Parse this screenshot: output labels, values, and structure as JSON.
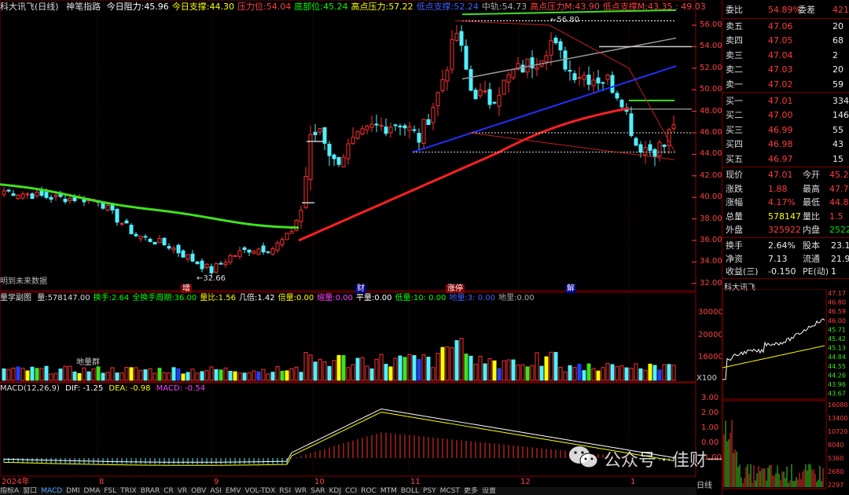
{
  "header": {
    "stock_name": "科大讯飞(日线)",
    "indicator": "神笔指路",
    "items": [
      {
        "label": "今日阻力:",
        "value": "45.96",
        "color": "#ffffff"
      },
      {
        "label": "今日支撑:",
        "value": "44.30",
        "color": "#ffff00"
      },
      {
        "label": "压力位:",
        "value": "54.04",
        "color": "#ff4040"
      },
      {
        "label": "底部位:",
        "value": "45.24",
        "color": "#00ff00"
      },
      {
        "label": "高点压力:",
        "value": "57.22",
        "color": "#ffff00"
      },
      {
        "label": "低点支撑:",
        "value": "52.24",
        "color": "#4060ff"
      },
      {
        "label": "中轨:",
        "value": "54.73",
        "color": "#aaaaaa"
      },
      {
        "label": "高点压力M:",
        "value": "43.90",
        "color": "#ff4040"
      },
      {
        "label": "低点支撑M:",
        "value": "43.35 : 49.03",
        "color": "#ff4040"
      }
    ],
    "future_note": "明到未来数据",
    "low_label": "32.66",
    "high_label": "56.80",
    "events": [
      "增",
      "财",
      "涨停",
      "解"
    ]
  },
  "volume_header": {
    "title": "量学副图",
    "items": [
      {
        "label": "量:",
        "value": "578147.00",
        "color": "#dddddd"
      },
      {
        "label": "换手:",
        "value": "2.64",
        "color": "#00ff00"
      },
      {
        "label": "全换手周期:",
        "value": "36.00",
        "color": "#00ff00"
      },
      {
        "label": "量比:",
        "value": "1.56",
        "color": "#ffff00"
      },
      {
        "label": "几倍:",
        "value": "1.42",
        "color": "#ffffff"
      },
      {
        "label": "倍量:",
        "value": "0.00",
        "color": "#ffff00"
      },
      {
        "label": "缩量:",
        "value": "0.00",
        "color": "#ff40ff"
      },
      {
        "label": "平量:",
        "value": "0.00",
        "color": "#ffffff"
      },
      {
        "label": "低量:",
        "value": "10: 0.00",
        "color": "#00ff00"
      },
      {
        "label": "地量:",
        "value": "3: 0.00",
        "color": "#4060ff"
      },
      {
        "label": "地里:",
        "value": "0.00",
        "color": "#aaaaaa"
      }
    ],
    "floor_label": "地量群"
  },
  "macd_header": {
    "title": "MACD(12,26,9)",
    "dif": "DIF: -1.25",
    "dea": "DEA: -0.98",
    "macd": "MACD: -0.54"
  },
  "months": [
    "2024年",
    "8",
    "9",
    "10",
    "11",
    "12",
    "1"
  ],
  "price_axis": [
    "56.00",
    "54.00",
    "52.00",
    "50.00",
    "48.00",
    "46.00",
    "44.00",
    "42.00",
    "40.00",
    "38.00",
    "36.00",
    "34.00",
    "32.00"
  ],
  "volume_axis": [
    "30000",
    "20000",
    "16000"
  ],
  "volume_unit": "X100",
  "macd_axis": [
    "3.00",
    "2.00",
    "1.00",
    "0.00",
    "-1.00"
  ],
  "quote": {
    "webi_label": "委比",
    "webi": "54.89%",
    "weicha_label": "委差",
    "weicha": "421",
    "asks": [
      {
        "label": "卖五",
        "price": "47.06",
        "vol": "20"
      },
      {
        "label": "卖四",
        "price": "47.05",
        "vol": "68"
      },
      {
        "label": "卖三",
        "price": "47.04",
        "vol": "2"
      },
      {
        "label": "卖二",
        "price": "47.03",
        "vol": "20"
      },
      {
        "label": "卖一",
        "price": "47.02",
        "vol": "59"
      }
    ],
    "bids": [
      {
        "label": "买一",
        "price": "47.01",
        "vol": "334"
      },
      {
        "label": "买二",
        "price": "47.00",
        "vol": "146"
      },
      {
        "label": "买三",
        "price": "46.99",
        "vol": "55"
      },
      {
        "label": "买四",
        "price": "46.98",
        "vol": "43"
      },
      {
        "label": "买五",
        "price": "46.97",
        "vol": "15"
      }
    ],
    "stats": [
      {
        "l1": "现价",
        "v1": "47.01",
        "l2": "今开",
        "v2": "45.2"
      },
      {
        "l1": "涨跌",
        "v1": "1.88",
        "l2": "最高",
        "v2": "47.7"
      },
      {
        "l1": "涨幅",
        "v1": "4.17%",
        "l2": "最低",
        "v2": "44.8"
      },
      {
        "l1": "总量",
        "v1": "578147",
        "l2": "量比",
        "v2": "1.5"
      },
      {
        "l1": "外盘",
        "v1": "325922",
        "l2": "内盘",
        "v2": "25222"
      }
    ],
    "stats2": [
      {
        "l1": "换手",
        "v1": "2.64%",
        "l2": "股本",
        "v2": "23.1"
      },
      {
        "l1": "净资",
        "v1": "7.13",
        "l2": "流通",
        "v2": "21.9"
      },
      {
        "l1": "收益(三)",
        "v1": "-0.150",
        "l2": "PE(动)",
        "v2": "1"
      }
    ],
    "mini_title": "科大讯飞",
    "mini_axis": [
      "47.17",
      "46.80",
      "46.59",
      "46.00",
      "45.71",
      "45.42",
      "45.13",
      "44.84",
      "44.55",
      "44.26",
      "43.96",
      "43.67"
    ],
    "mini_vol_axis": [
      "16080",
      "13400",
      "10720",
      "8040",
      "5360",
      "2680",
      "2297"
    ],
    "side_tabs": [
      "日线"
    ],
    "mini_tabs": [
      "指标",
      "模",
      "板"
    ]
  },
  "bottom_tabs": [
    "指标A",
    "窗口",
    "MACD",
    "DMI",
    "DMA",
    "FSL",
    "TRIX",
    "BRAR",
    "CR",
    "VR",
    "OBV",
    "ASI",
    "EMV",
    "VOL-TDX",
    "RSI",
    "WR",
    "SAR",
    "KDJ",
    "CCI",
    "ROC",
    "MTM",
    "BOLL",
    "PSY",
    "MCST",
    "更多",
    "设置"
  ],
  "watermark": "公众号 · 佳财一分钟",
  "colors": {
    "up": "#ff3030",
    "down": "#50f0ff",
    "ma_red": "#ff2020",
    "ma_green": "#40e020",
    "blue": "#2030ff",
    "grid": "#8b0000"
  }
}
